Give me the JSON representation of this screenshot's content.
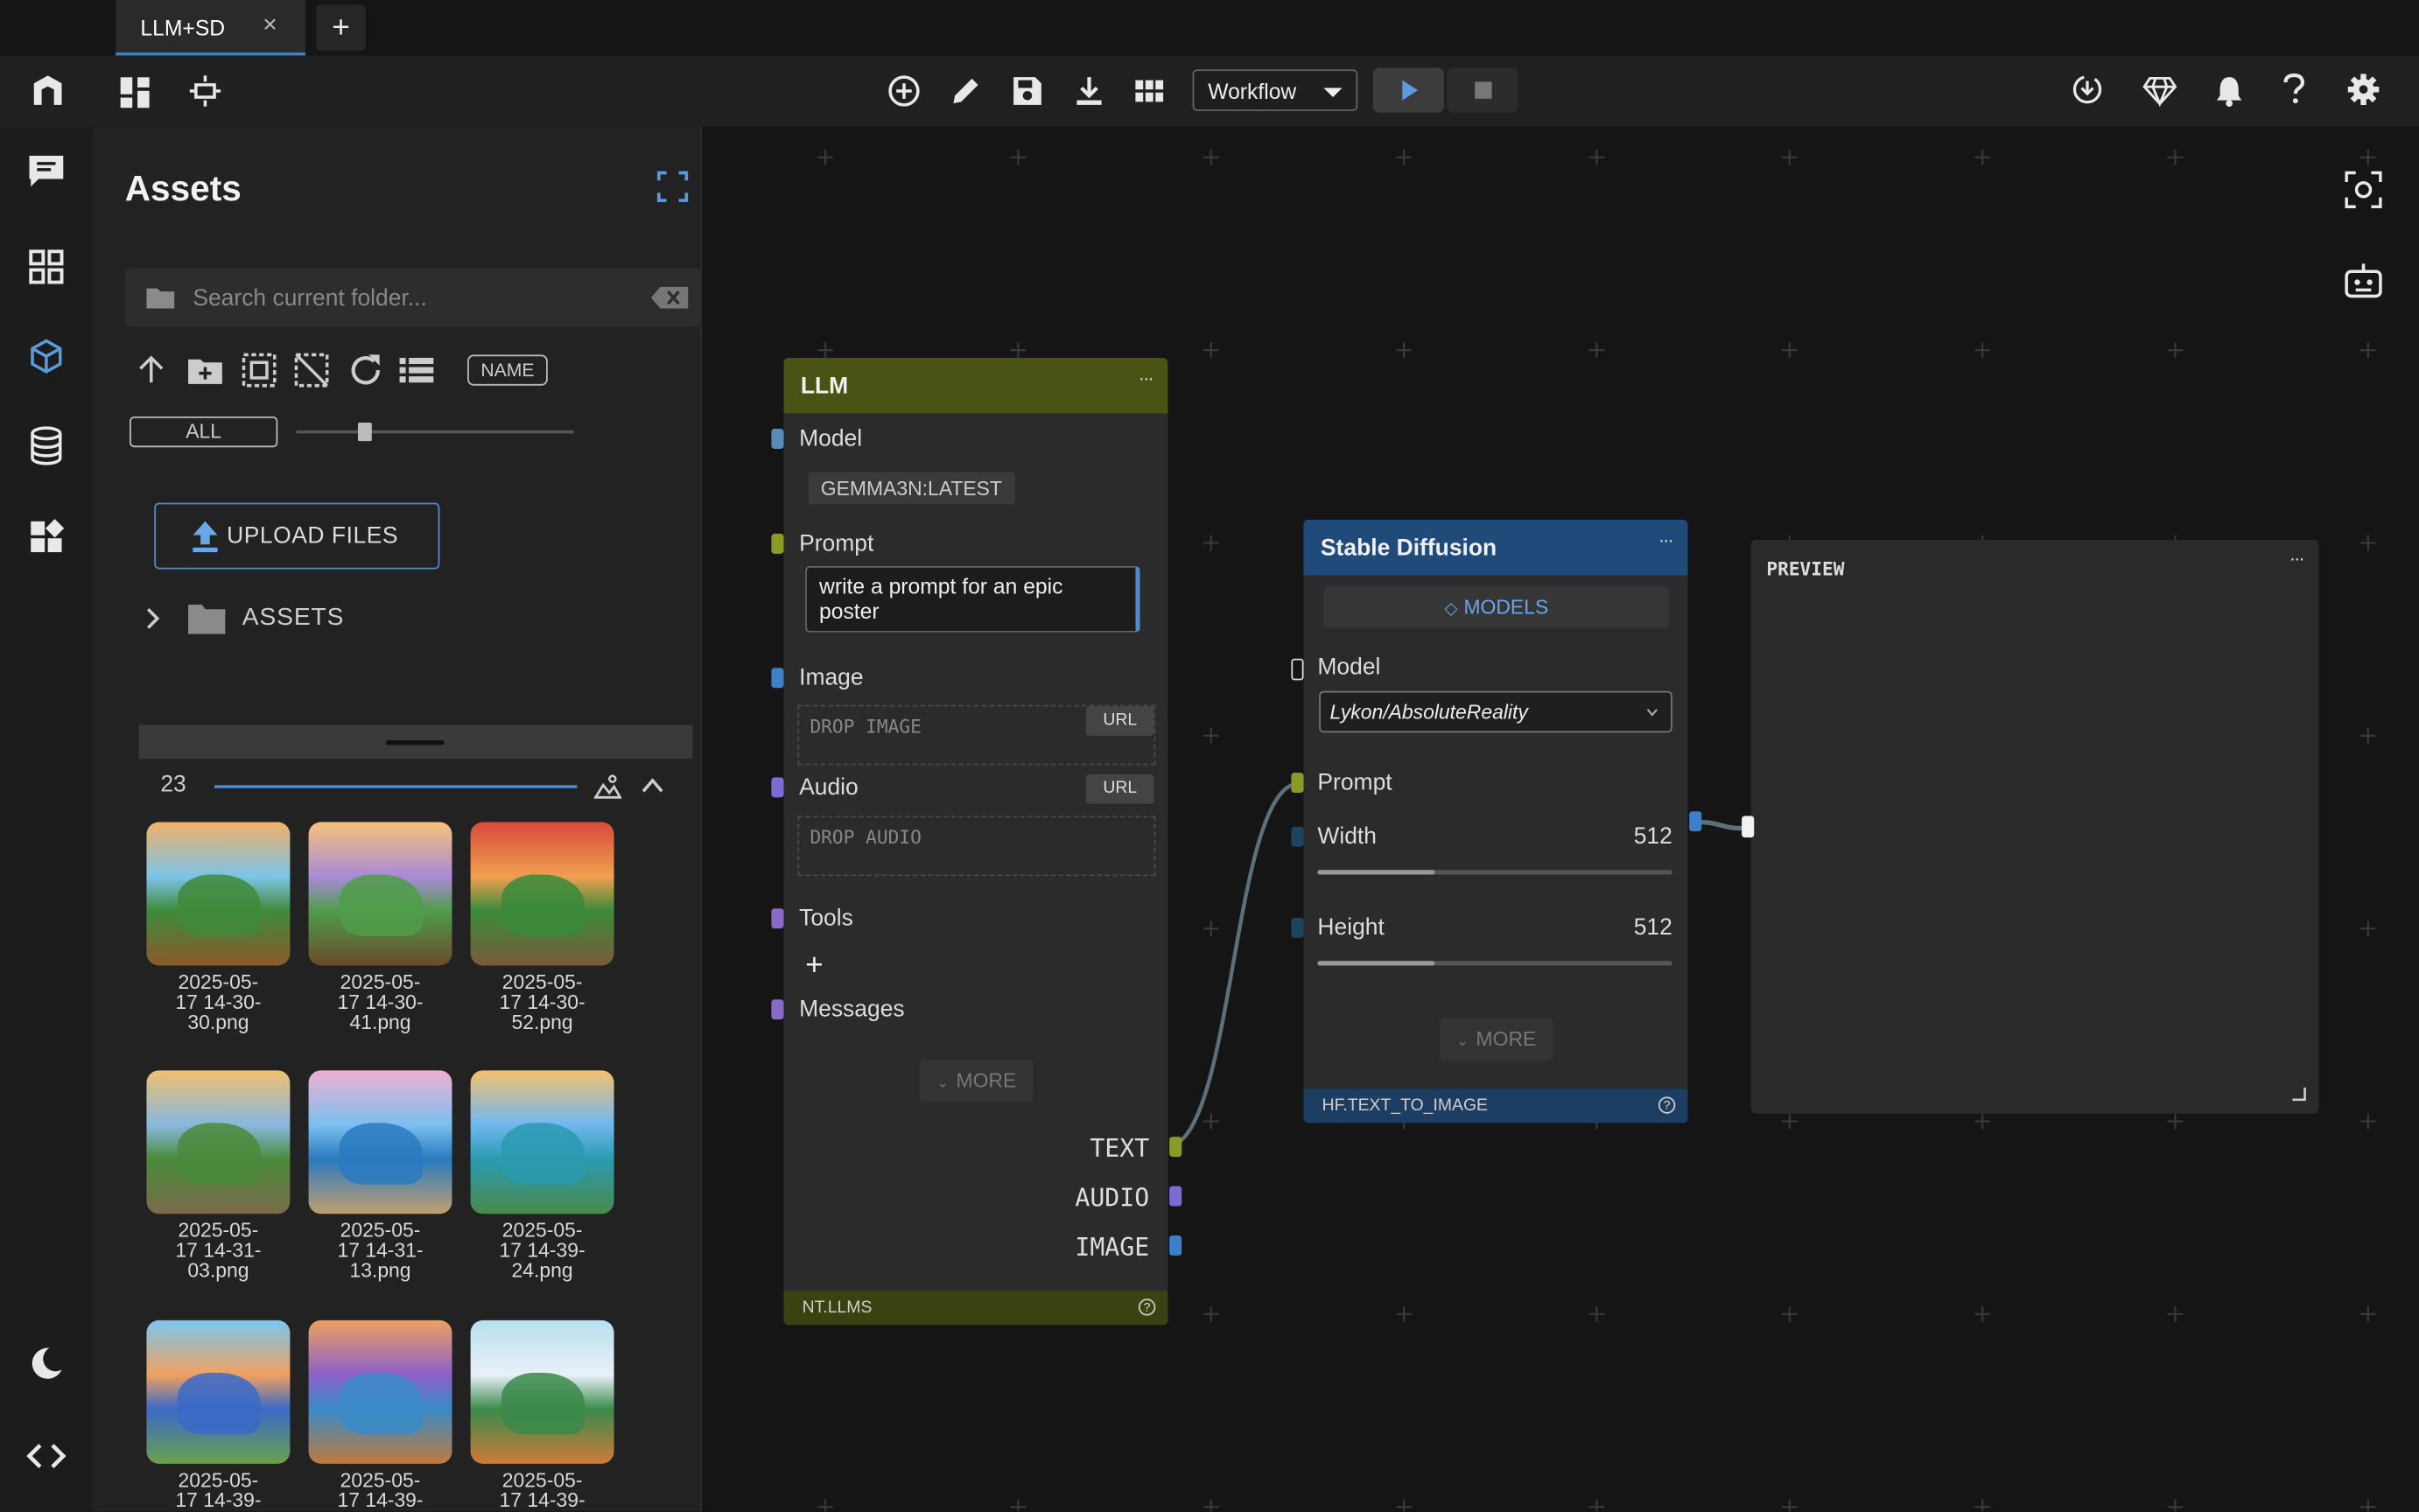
{
  "tab": {
    "label": "LLM+SD",
    "close": "×",
    "new_tab": "+"
  },
  "toolbar": {
    "workflow_select": "Workflow"
  },
  "assets": {
    "title": "Assets",
    "search_placeholder": "Search current folder...",
    "sort_label": "NAME",
    "filter_label": "ALL",
    "upload_label": "UPLOAD FILES",
    "folder_label": "ASSETS",
    "count": "23",
    "items": [
      {
        "line1": "2025-05-",
        "line2": "17 14-30-",
        "line3": "30.png"
      },
      {
        "line1": "2025-05-",
        "line2": "17 14-30-",
        "line3": "41.png"
      },
      {
        "line1": "2025-05-",
        "line2": "17 14-30-",
        "line3": "52.png"
      },
      {
        "line1": "2025-05-",
        "line2": "17 14-31-",
        "line3": "03.png"
      },
      {
        "line1": "2025-05-",
        "line2": "17 14-31-",
        "line3": "13.png"
      },
      {
        "line1": "2025-05-",
        "line2": "17 14-39-",
        "line3": "24.png"
      },
      {
        "line1": "2025-05-",
        "line2": "17 14-39-",
        "line3": ""
      },
      {
        "line1": "2025-05-",
        "line2": "17 14-39-",
        "line3": ""
      },
      {
        "line1": "2025-05-",
        "line2": "17 14-39-",
        "line3": ""
      }
    ]
  },
  "llm_node": {
    "title": "LLM",
    "menu": "···",
    "model_label": "Model",
    "model_value": "GEMMA3N:LATEST",
    "prompt_label": "Prompt",
    "prompt_value": "write a prompt for an epic poster",
    "image_label": "Image",
    "image_drop": "DROP IMAGE",
    "url_label": "URL",
    "audio_label": "Audio",
    "audio_drop": "DROP AUDIO",
    "tools_label": "Tools",
    "tools_add": "+",
    "messages_label": "Messages",
    "more_label": "MORE",
    "out_text": "TEXT",
    "out_audio": "AUDIO",
    "out_image": "IMAGE",
    "footer": "NT.LLMS",
    "help": "?"
  },
  "sd_node": {
    "title": "Stable Diffusion",
    "menu": "···",
    "models_button": "MODELS",
    "model_label": "Model",
    "model_value": "Lykon/AbsoluteReality",
    "prompt_label": "Prompt",
    "width_label": "Width",
    "width_value": "512",
    "width_fraction": 0.33,
    "height_label": "Height",
    "height_value": "512",
    "height_fraction": 0.33,
    "more_label": "MORE",
    "footer": "HF.TEXT_TO_IMAGE",
    "help": "?"
  },
  "preview_node": {
    "title": "PREVIEW",
    "menu": "···"
  },
  "colors": {
    "llm_header": "#4a5214",
    "sd_header": "#1f4a7a",
    "accent": "#4f8bd1",
    "edge": "#5d7077"
  }
}
